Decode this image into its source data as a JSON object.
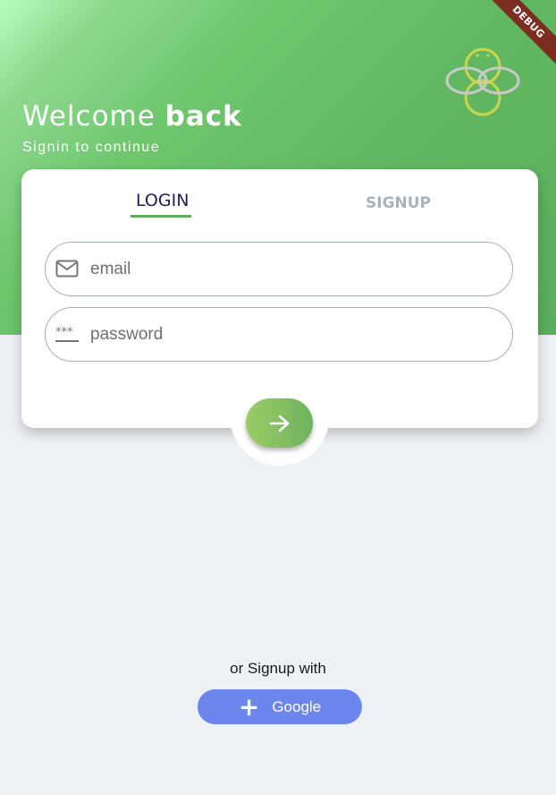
{
  "header": {
    "greeting_plain": "Welcome ",
    "greeting_bold": "back",
    "subtitle": "Signin to continue",
    "debug_banner": "DEBUG",
    "background_colors": [
      "#b6ffbf",
      "#6ec66d",
      "#5bae5c"
    ]
  },
  "tabs": [
    {
      "label": "LOGIN",
      "active": true
    },
    {
      "label": "SIGNUP",
      "active": false
    }
  ],
  "form": {
    "email": {
      "placeholder": "email",
      "value": "",
      "icon": "mail-icon"
    },
    "password": {
      "placeholder": "password",
      "value": "",
      "icon": "password-dots-icon"
    },
    "submit_icon": "arrow-right-icon"
  },
  "social": {
    "prompt": "or Signup with",
    "google_label": "Google",
    "google_icon": "plus-icon",
    "google_color": "#6b86ec"
  },
  "colors": {
    "accent_green": "#5fae5f",
    "active_tab_text": "#1f1b5c",
    "inactive_tab_text": "#a6b3bf",
    "page_background": "#edf1f6"
  }
}
